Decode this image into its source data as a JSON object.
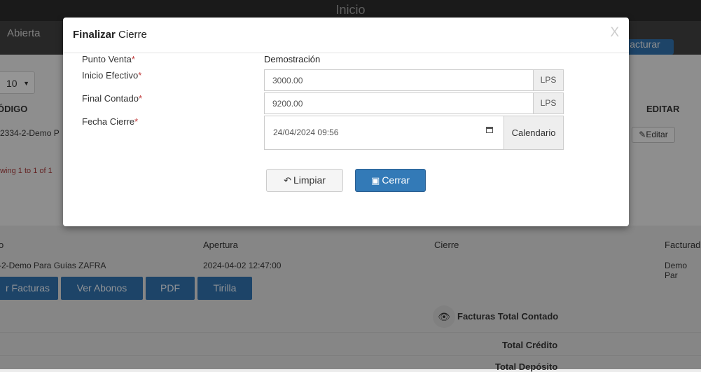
{
  "topbar": {
    "title": "Inicio"
  },
  "navbar": {
    "status": "Abierta",
    "button_label": "acturar"
  },
  "list": {
    "length_value": "10",
    "col_codigo": "ÓDIGO",
    "col_editar": "EDITAR",
    "row_code": "-2334-2-Demo P",
    "edit_label": "Editar",
    "showing": "owing 1 to 1 of 1"
  },
  "detail": {
    "col_left": "o",
    "col_apertura": "Apertura",
    "col_cierre": "Cierre",
    "col_facturado": "Facturad",
    "row_name": "-2-Demo Para Guías ZAFRA",
    "row_apertura": "2024-04-02 12:47:00",
    "row_facturado": "Demo Par",
    "buttons": [
      "r Facturas",
      "Ver Abonos",
      "PDF",
      "Tirilla"
    ],
    "totals": [
      "Facturas Total Contado",
      "Total Crédito",
      "Total Depósito"
    ]
  },
  "modal": {
    "title_bold": "Finalizar",
    "title_rest": "Cierre",
    "close": "X",
    "labels": {
      "punto_venta": "Punto Venta",
      "inicio_efectivo": "Inicio Efectivo",
      "final_contado": "Final Contado",
      "fecha_cierre": "Fecha Cierre"
    },
    "required_mark": "*",
    "punto_venta_value": "Demostración",
    "inicio_efectivo_value": "3000.00",
    "final_contado_value": "9200.00",
    "currency": "LPS",
    "fecha_cierre_value": "24/04/2024 09:56",
    "calendar_label": "Calendario",
    "limpiar_label": "Limpiar",
    "cerrar_label": "Cerrar"
  },
  "colors": {
    "primary": "#337ab7",
    "required": "#c03a3a",
    "topbar": "#2a2a2a"
  },
  "icons": {
    "close": "close-icon",
    "calendar": "calendar-icon",
    "undo": "undo-icon",
    "save": "save-icon",
    "eye": "eye-icon",
    "pencil": "pencil-icon"
  }
}
